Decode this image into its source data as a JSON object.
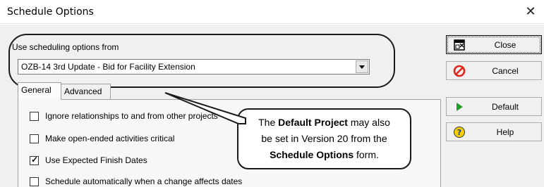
{
  "window": {
    "title": "Schedule Options",
    "close_glyph": "✕"
  },
  "scheduling": {
    "label": "Use scheduling options from",
    "selected_project": "OZB-14 3rd Update - Bid for Facility Extension"
  },
  "tabs": [
    {
      "label": "General",
      "active": true
    },
    {
      "label": "Advanced",
      "active": false
    }
  ],
  "options": [
    {
      "label": "Ignore relationships to and from other projects",
      "checked": false
    },
    {
      "label": "Make open-ended activities critical",
      "checked": false
    },
    {
      "label": "Use Expected Finish Dates",
      "checked": true
    },
    {
      "label": "Schedule automatically when a change affects dates",
      "checked": false
    }
  ],
  "callout": {
    "line1_pre": "The ",
    "line1_bold": "Default Project",
    "line1_post": " may also",
    "line2": "be set in Version 20 from the",
    "line3_bold": "Schedule Options",
    "line3_post": " form."
  },
  "buttons": {
    "close": "Close",
    "cancel": "Cancel",
    "default": "Default",
    "help": "Help"
  },
  "icons": {
    "close_button": "window-close-icon",
    "cancel_button": "no-entry-icon",
    "default_button": "play-triangle-icon",
    "help_button": "question-icon"
  },
  "colors": {
    "cancel_red": "#e0261a",
    "default_green": "#1f9e2a",
    "help_yellow": "#f5d000"
  }
}
